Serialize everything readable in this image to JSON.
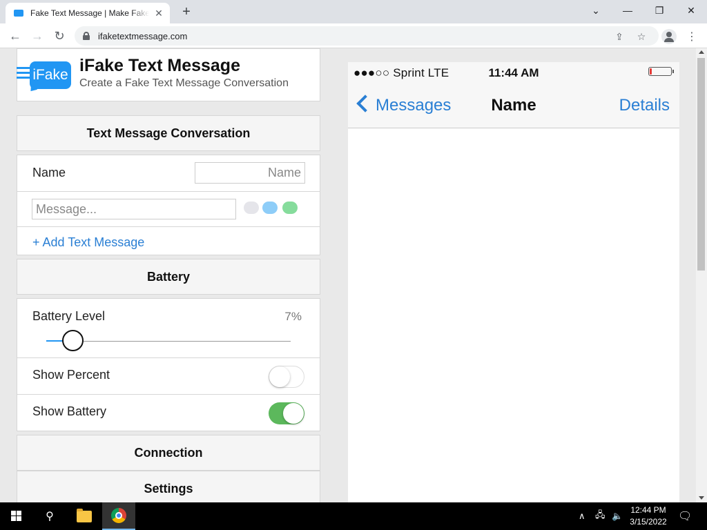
{
  "browser": {
    "tab_title": "Fake Text Message | Make Fake Text Messages",
    "tab_close": "✕",
    "new_tab": "+",
    "url": "ifaketextmessage.com",
    "window": {
      "minimize": "—",
      "restore": "❐",
      "close": "✕",
      "tabs_dropdown": "⌄"
    }
  },
  "site": {
    "logo_text": "iFake",
    "title": "iFake Text Message",
    "subtitle": "Create a Fake Text Message Conversation",
    "accent_color": "#2196f3"
  },
  "conversation": {
    "section_title": "Text Message Conversation",
    "name_label": "Name",
    "name_placeholder": "Name",
    "message_placeholder": "Message...",
    "add_link": "+ Add Text Message"
  },
  "battery": {
    "section_title": "Battery",
    "level_label": "Battery Level",
    "level_percent_text": "7%",
    "level_fraction": 0.07,
    "show_percent_label": "Show Percent",
    "show_percent_on": false,
    "show_battery_label": "Show Battery",
    "show_battery_on": true
  },
  "sections": {
    "connection": "Connection",
    "settings": "Settings"
  },
  "phone": {
    "carrier": "●●●○○ Sprint  LTE",
    "time": "11:44 AM",
    "back_label": "Messages",
    "contact_name": "Name",
    "details_label": "Details",
    "battery_color": "#e53935",
    "link_color": "#2a7fd4"
  },
  "taskbar": {
    "time": "12:44 PM",
    "date": "3/15/2022"
  }
}
